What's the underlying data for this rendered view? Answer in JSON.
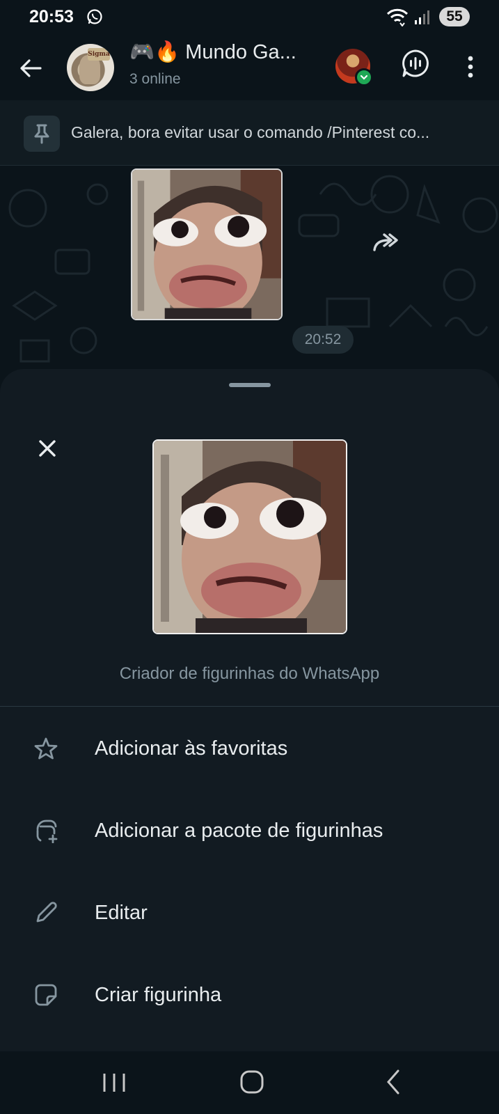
{
  "status_bar": {
    "time": "20:53",
    "battery": "55",
    "app_icon": "whatsapp-icon",
    "indicators": [
      "wifi-icon",
      "signal-icon"
    ]
  },
  "header": {
    "title": "🎮🔥 Mundo Ga...",
    "subtitle": "3 online",
    "avatar_sign_text": "Sigma",
    "icons": [
      "back-arrow-icon",
      "voice-chat-icon",
      "more-vert-icon"
    ]
  },
  "pinned": {
    "icon": "pin-icon",
    "text": "Galera, bora evitar usar o comando /Pinterest co..."
  },
  "chat": {
    "message_time": "20:52",
    "forward_icon": "forward-icon"
  },
  "sheet": {
    "close_icon": "close-icon",
    "caption": "Criador de figurinhas do WhatsApp",
    "menu": [
      {
        "icon": "star-icon",
        "label": "Adicionar às favoritas"
      },
      {
        "icon": "add-sticker-pack-icon",
        "label": "Adicionar a pacote de figurinhas"
      },
      {
        "icon": "pencil-icon",
        "label": "Editar"
      },
      {
        "icon": "sticker-icon",
        "label": "Criar figurinha"
      }
    ]
  },
  "nav_bar": {
    "icons": [
      "recent-apps-icon",
      "home-icon",
      "nav-back-icon"
    ]
  },
  "colors": {
    "background": "#0b141a",
    "sheet": "#121b22",
    "text_primary": "#e9edef",
    "text_secondary": "#8696a0",
    "accent_green": "#1fa855"
  }
}
